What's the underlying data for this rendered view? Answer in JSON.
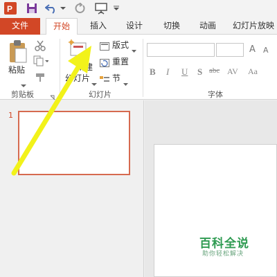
{
  "app": {
    "icon": "powerpoint-app-icon",
    "brand_color": "#d24726"
  },
  "quick_access": {
    "icons": [
      "powerpoint-logo-icon",
      "save-icon",
      "undo-icon",
      "dropdown-icon",
      "redo-icon",
      "present-icon",
      "customize-icon"
    ]
  },
  "tabs": [
    {
      "label": "文件"
    },
    {
      "label": "开始"
    },
    {
      "label": "插入"
    },
    {
      "label": "设计"
    },
    {
      "label": "切换"
    },
    {
      "label": "动画"
    },
    {
      "label": "幻灯片放映"
    }
  ],
  "ribbon": {
    "clipboard": {
      "paste_label": "粘贴",
      "group_label": "剪贴板"
    },
    "slides": {
      "new_slide_label": "新建",
      "new_slide_label_2": "幻灯片",
      "layout_label": "版式",
      "reset_label": "重置",
      "section_label": "节",
      "group_label": "幻灯片"
    },
    "font": {
      "group_label": "字体",
      "grow_label": "A",
      "shrink_label": "A",
      "bold": "B",
      "italic": "I",
      "underline": "U",
      "shadow": "S",
      "strikethrough": "abc",
      "spacing": "AV",
      "case": "Aa"
    }
  },
  "thumbnails": [
    {
      "number": "1"
    }
  ],
  "watermark": {
    "title": "百科全说",
    "subtitle": "助你轻松解决"
  },
  "annotation": {
    "arrow_color": "#f2f21a"
  }
}
